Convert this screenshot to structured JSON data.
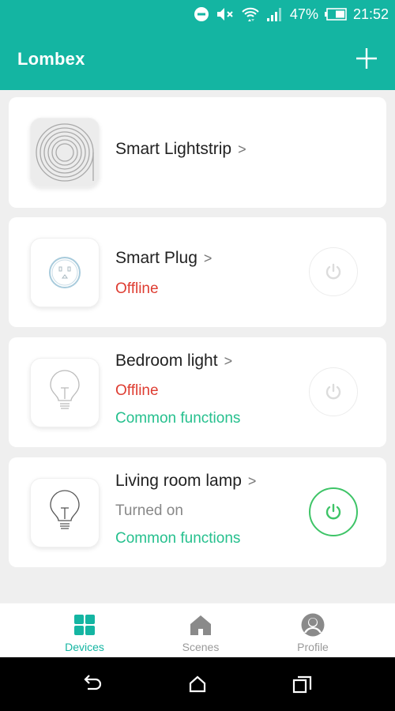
{
  "status_bar": {
    "icons": [
      "do-not-disturb-icon",
      "mute-icon",
      "wifi-icon",
      "signal-icon"
    ],
    "battery": "47%",
    "time": "21:52"
  },
  "app_bar": {
    "title": "Lombex",
    "add_icon": "plus-icon"
  },
  "devices": [
    {
      "name": "Smart Lightstrip",
      "icon": "lightstrip-icon",
      "status": null,
      "common_functions": null,
      "has_power": false
    },
    {
      "name": "Smart Plug",
      "icon": "smart-plug-icon",
      "status": "Offline",
      "common_functions": null,
      "has_power": true,
      "power_on": false
    },
    {
      "name": "Bedroom light",
      "icon": "light-bulb-icon",
      "status": "Offline",
      "common_functions": "Common functions",
      "has_power": true,
      "power_on": false
    },
    {
      "name": "Living room lamp",
      "icon": "light-bulb-icon",
      "status": "Turned on",
      "common_functions": "Common functions",
      "has_power": true,
      "power_on": true
    }
  ],
  "tabs": [
    {
      "label": "Devices",
      "icon": "grid-icon",
      "active": true
    },
    {
      "label": "Scenes",
      "icon": "home-icon",
      "active": false
    },
    {
      "label": "Profile",
      "icon": "profile-icon",
      "active": false
    }
  ],
  "chevron": ">",
  "colors": {
    "brand": "#14b5a2",
    "offline": "#de3d32",
    "common": "#26c08e",
    "power_on": "#3ec467"
  }
}
